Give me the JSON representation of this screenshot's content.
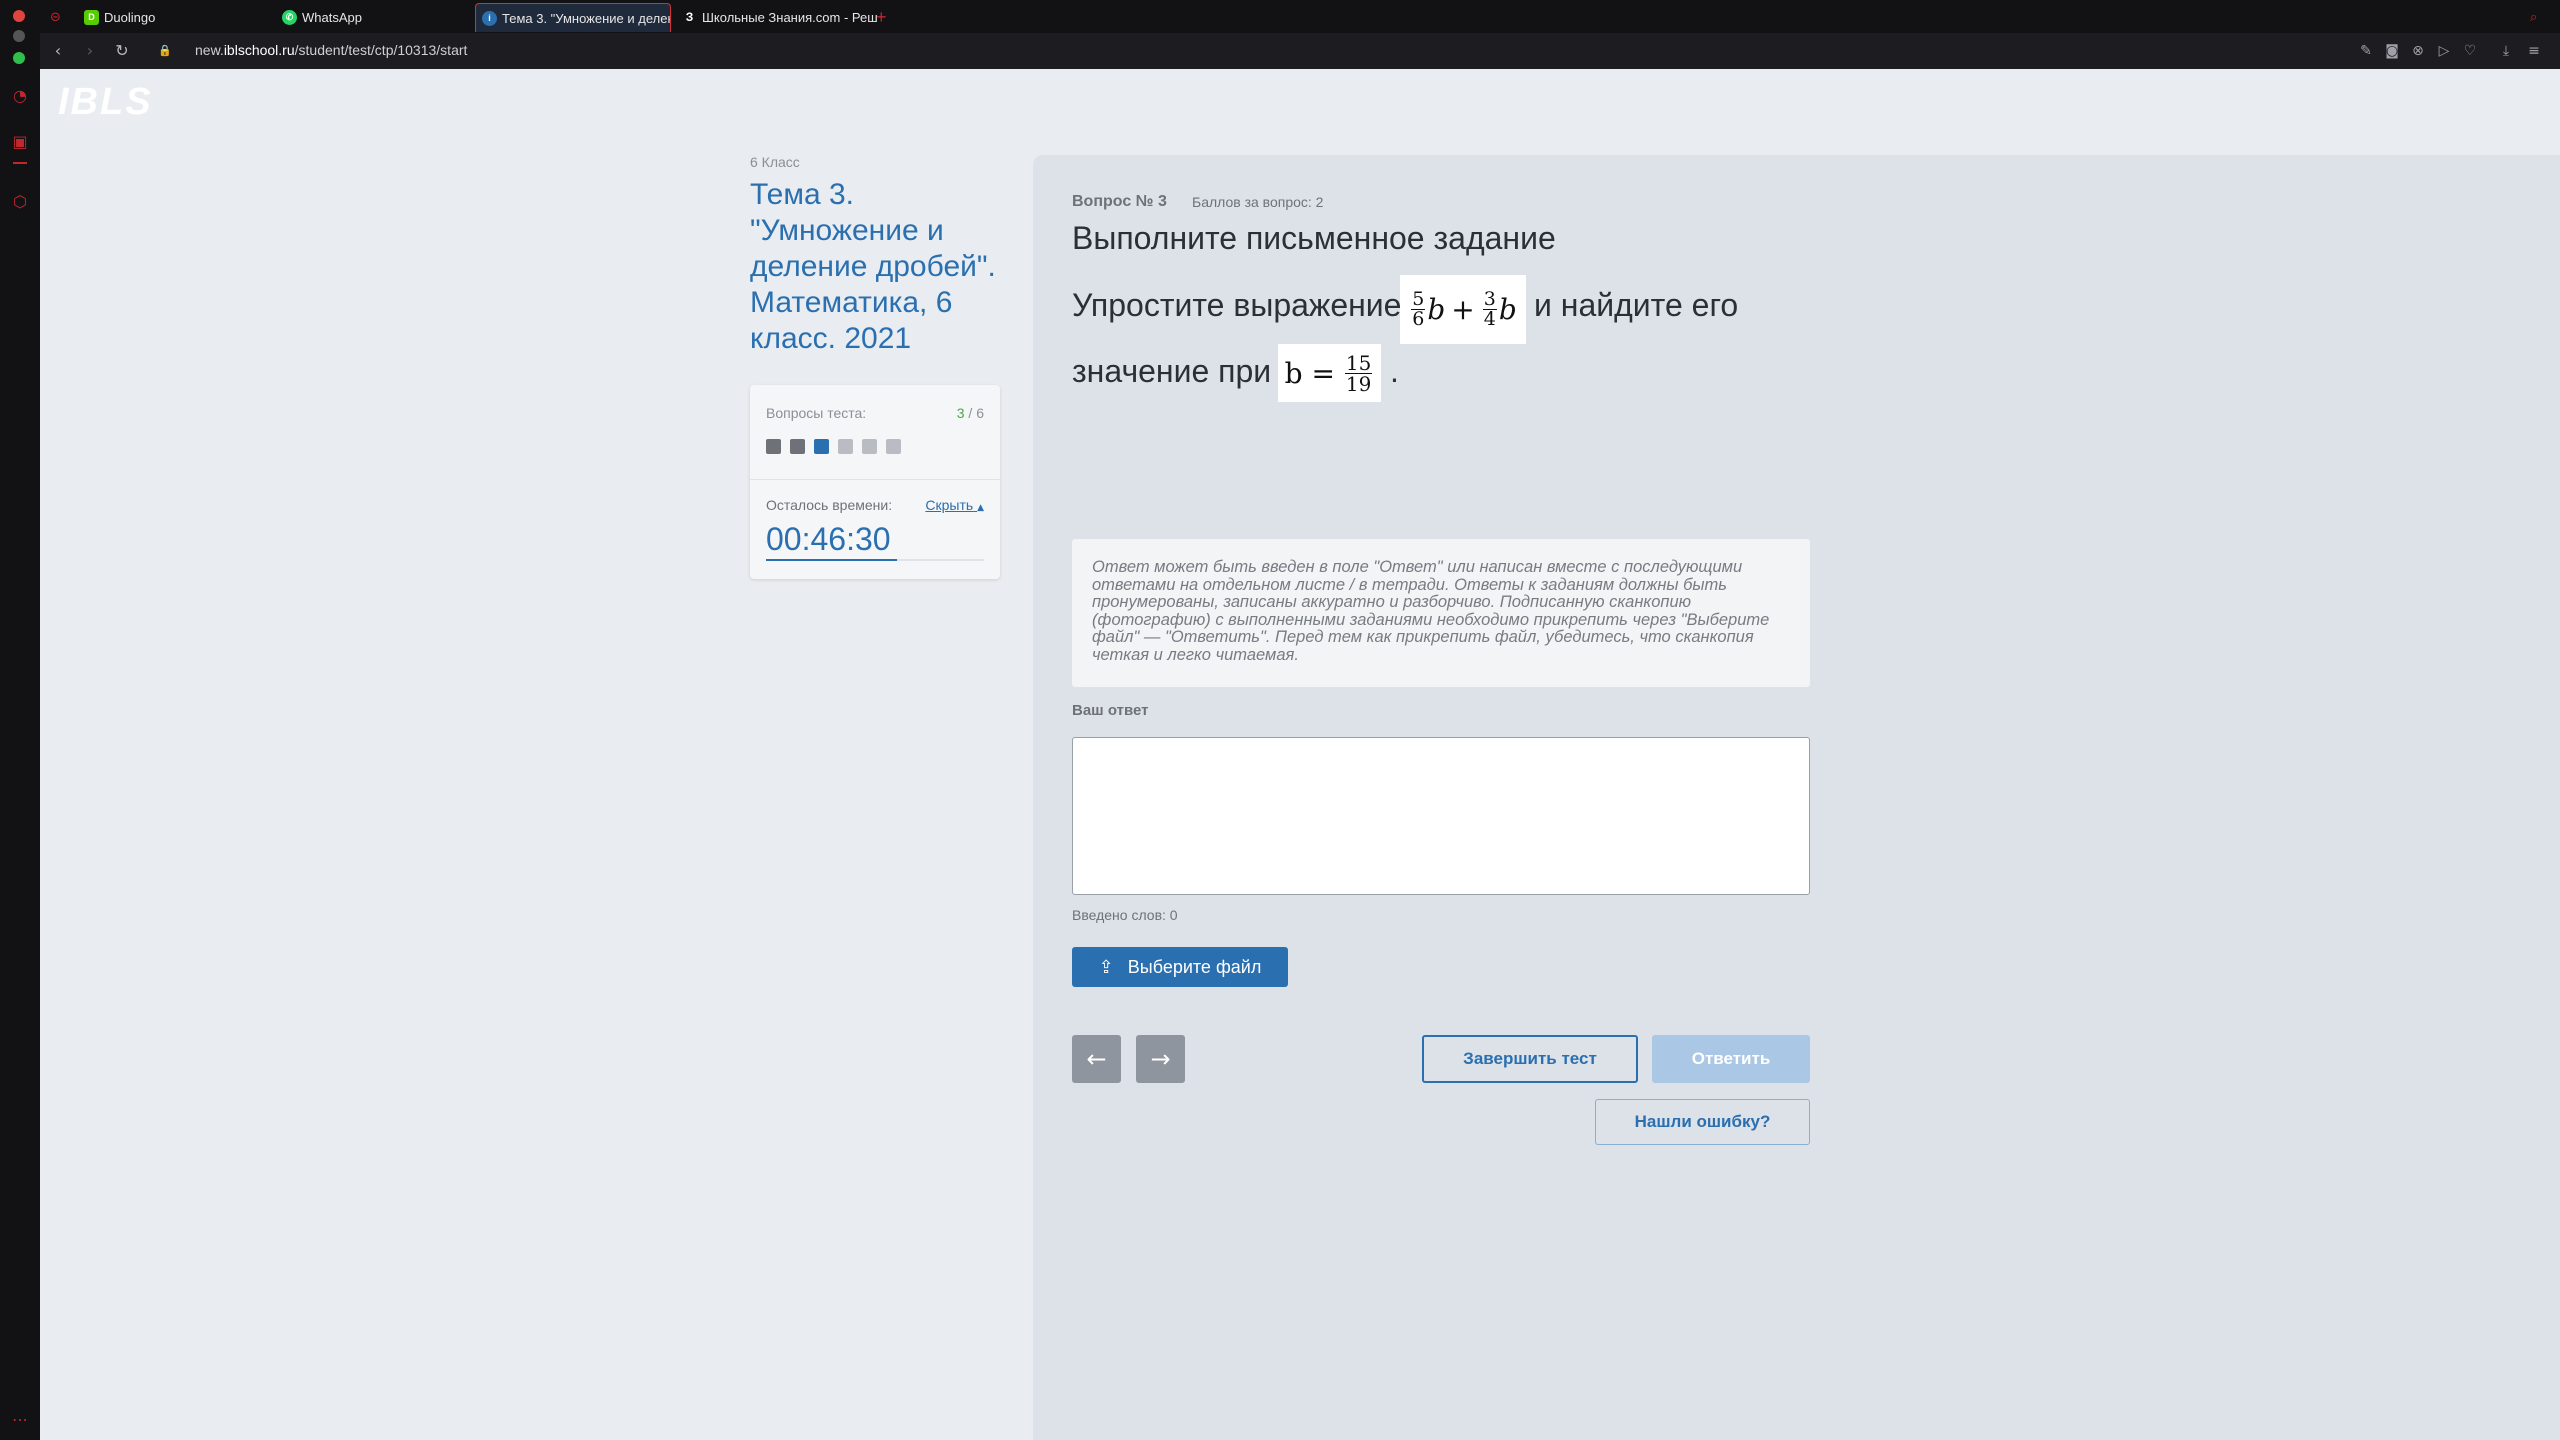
{
  "browser": {
    "tabs": [
      {
        "label": "Duolingo",
        "favicon": "duolingo-icon"
      },
      {
        "label": "WhatsApp",
        "favicon": "whatsapp-icon"
      },
      {
        "label": "Тема 3. \"Умножение и делени",
        "favicon": "ibls-icon",
        "active": true
      },
      {
        "label": "Школьные Знания.com - Реш",
        "favicon": "znanija-icon"
      }
    ],
    "new_tab": "+",
    "url_prefix": "new.",
    "url_domain": "iblschool.ru",
    "url_path": "/student/test/ctp/10313/start"
  },
  "site": {
    "logo": "IBLS"
  },
  "sidebar": {
    "grade": "6 Класс",
    "topic": "Тема 3. \"Умножение и деление дробей\". Математика, 6 класс. 2021"
  },
  "progress": {
    "label": "Вопросы теста:",
    "current": "3",
    "separator": " / ",
    "total": "6",
    "squares": [
      "done",
      "done",
      "current",
      "todo",
      "todo",
      "todo"
    ],
    "time_label": "Осталось времени:",
    "hide_label": "Скрыть",
    "timer": "00:46:30",
    "time_fraction": 0.6
  },
  "question": {
    "number": "Вопрос № 3",
    "points": "Баллов за вопрос: 2",
    "title": "Выполните письменное задание",
    "text_part1": "Упростите выражение",
    "text_part2": "и найдите его",
    "text_part3": "значение при",
    "text_part4": ".",
    "formula1": {
      "n1": "5",
      "d1": "6",
      "v": "b",
      "op": "+",
      "n2": "3",
      "d2": "4"
    },
    "formula2": {
      "lhs": "b =",
      "n": "15",
      "d": "19"
    },
    "hint": "Ответ может быть введен в поле \"Ответ\" или написан вместе с последующими ответами на отдельном листе / в тетради. Ответы к заданиям должны быть пронумерованы, записаны аккуратно и разборчиво. Подписанную сканкопию (фотографию) с выполненными заданиями необходимо прикрепить через \"Выберите файл\" — \"Ответить\". Перед тем как прикрепить файл, убедитесь, что сканкопия четкая и легко читаемая.",
    "answer_label": "Ваш ответ",
    "answer_value": "",
    "word_count": "Введено слов: 0",
    "file_button": "Выберите файл",
    "prev_button": "←",
    "next_button": "→",
    "finish_button": "Завершить тест",
    "submit_button": "Ответить",
    "error_button": "Нашли ошибку?"
  },
  "colors": {
    "accent": "#2a6fb0",
    "panel": "#dde2e8",
    "background": "#e9ecf0",
    "browser_red": "#c4262e"
  }
}
